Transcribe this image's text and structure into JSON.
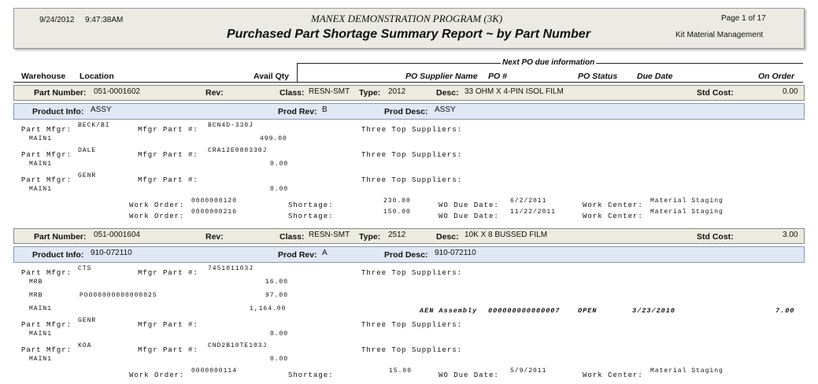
{
  "header": {
    "date": "9/24/2012",
    "time": "9:47:38AM",
    "company": "MANEX DEMONSTRATION PROGRAM (3K)",
    "title": "Purchased Part Shortage Summary Report ~ by Part Number",
    "page": "Page 1 of 17",
    "module": "Kit Material Management"
  },
  "columns": {
    "next_po": "Next PO due information",
    "warehouse": "Warehouse",
    "location": "Location",
    "avail_qty": "Avail Qty",
    "po_supplier": "PO Supplier Name",
    "po_num": "PO #",
    "po_status": "PO Status",
    "due_date": "Due Date",
    "on_order": "On Order"
  },
  "labels": {
    "part_number": "Part Number:",
    "rev": "Rev:",
    "class": "Class:",
    "type": "Type:",
    "desc": "Desc:",
    "std_cost": "Std Cost:",
    "product_info": "Product Info:",
    "prod_rev": "Prod Rev:",
    "prod_desc": "Prod Desc:",
    "part_mfgr": "Part Mfgr:",
    "mfgr_part": "Mfgr Part #:",
    "three_top": "Three Top Suppliers:",
    "work_order": "Work Order:",
    "shortage": "Shortage:",
    "wo_due": "WO Due Date:",
    "work_center": "Work Center:"
  },
  "part1": {
    "number": "051-0001602",
    "class": "RESN-SMT",
    "type": "2012",
    "desc": "33 OHM X 4-PIN ISOL FILM",
    "std_cost": "0.00",
    "product_info": "ASSY",
    "prod_rev": "B",
    "prod_desc": "ASSY",
    "mfgrs": [
      {
        "mfgr": "BECK/BI",
        "part": "BCN4D-330J",
        "warehouse": "MAIN1",
        "qty": "499.00"
      },
      {
        "mfgr": "DALE",
        "part": "CRA12E080330J",
        "warehouse": "MAIN1",
        "qty": "0.00"
      },
      {
        "mfgr": "GENR",
        "part": "",
        "warehouse": "MAIN1",
        "qty": "0.00"
      }
    ],
    "work_orders": [
      {
        "wo": "0000000120",
        "shortage": "230.00",
        "due": "6/2/2011",
        "center": "Material Staging"
      },
      {
        "wo": "0000000216",
        "shortage": "150.00",
        "due": "11/22/2011",
        "center": "Material Staging"
      }
    ]
  },
  "part2": {
    "number": "051-0001604",
    "class": "RESN-SMT",
    "type": "2512",
    "desc": "10K X 8 BUSSED FILM",
    "std_cost": "3.00",
    "product_info": "910-072110",
    "prod_rev": "A",
    "prod_desc": "910-072110",
    "cts": {
      "mfgr": "CTS",
      "part": "745101103J"
    },
    "rows": [
      {
        "warehouse": "MRB",
        "location": "",
        "qty": "16.00"
      },
      {
        "warehouse": "MRB",
        "location": "PO000000000000025",
        "qty": "97.00"
      },
      {
        "warehouse": "MAIN1",
        "location": "",
        "qty": "1,164.00"
      }
    ],
    "po": {
      "supplier": "AEN Assembly",
      "number": "000000000000007",
      "status": "OPEN",
      "due": "3/23/2010",
      "on_order": "7.00"
    },
    "mfgrs": [
      {
        "mfgr": "GENR",
        "part": "",
        "warehouse": "MAIN1",
        "qty": "0.00"
      },
      {
        "mfgr": "KOA",
        "part": "CND2B10TE103J",
        "warehouse": "MAIN1",
        "qty": "0.00"
      }
    ],
    "work_order": {
      "wo": "0000000114",
      "shortage": "15.00",
      "due": "5/9/2011",
      "center": "Material Staging"
    }
  }
}
